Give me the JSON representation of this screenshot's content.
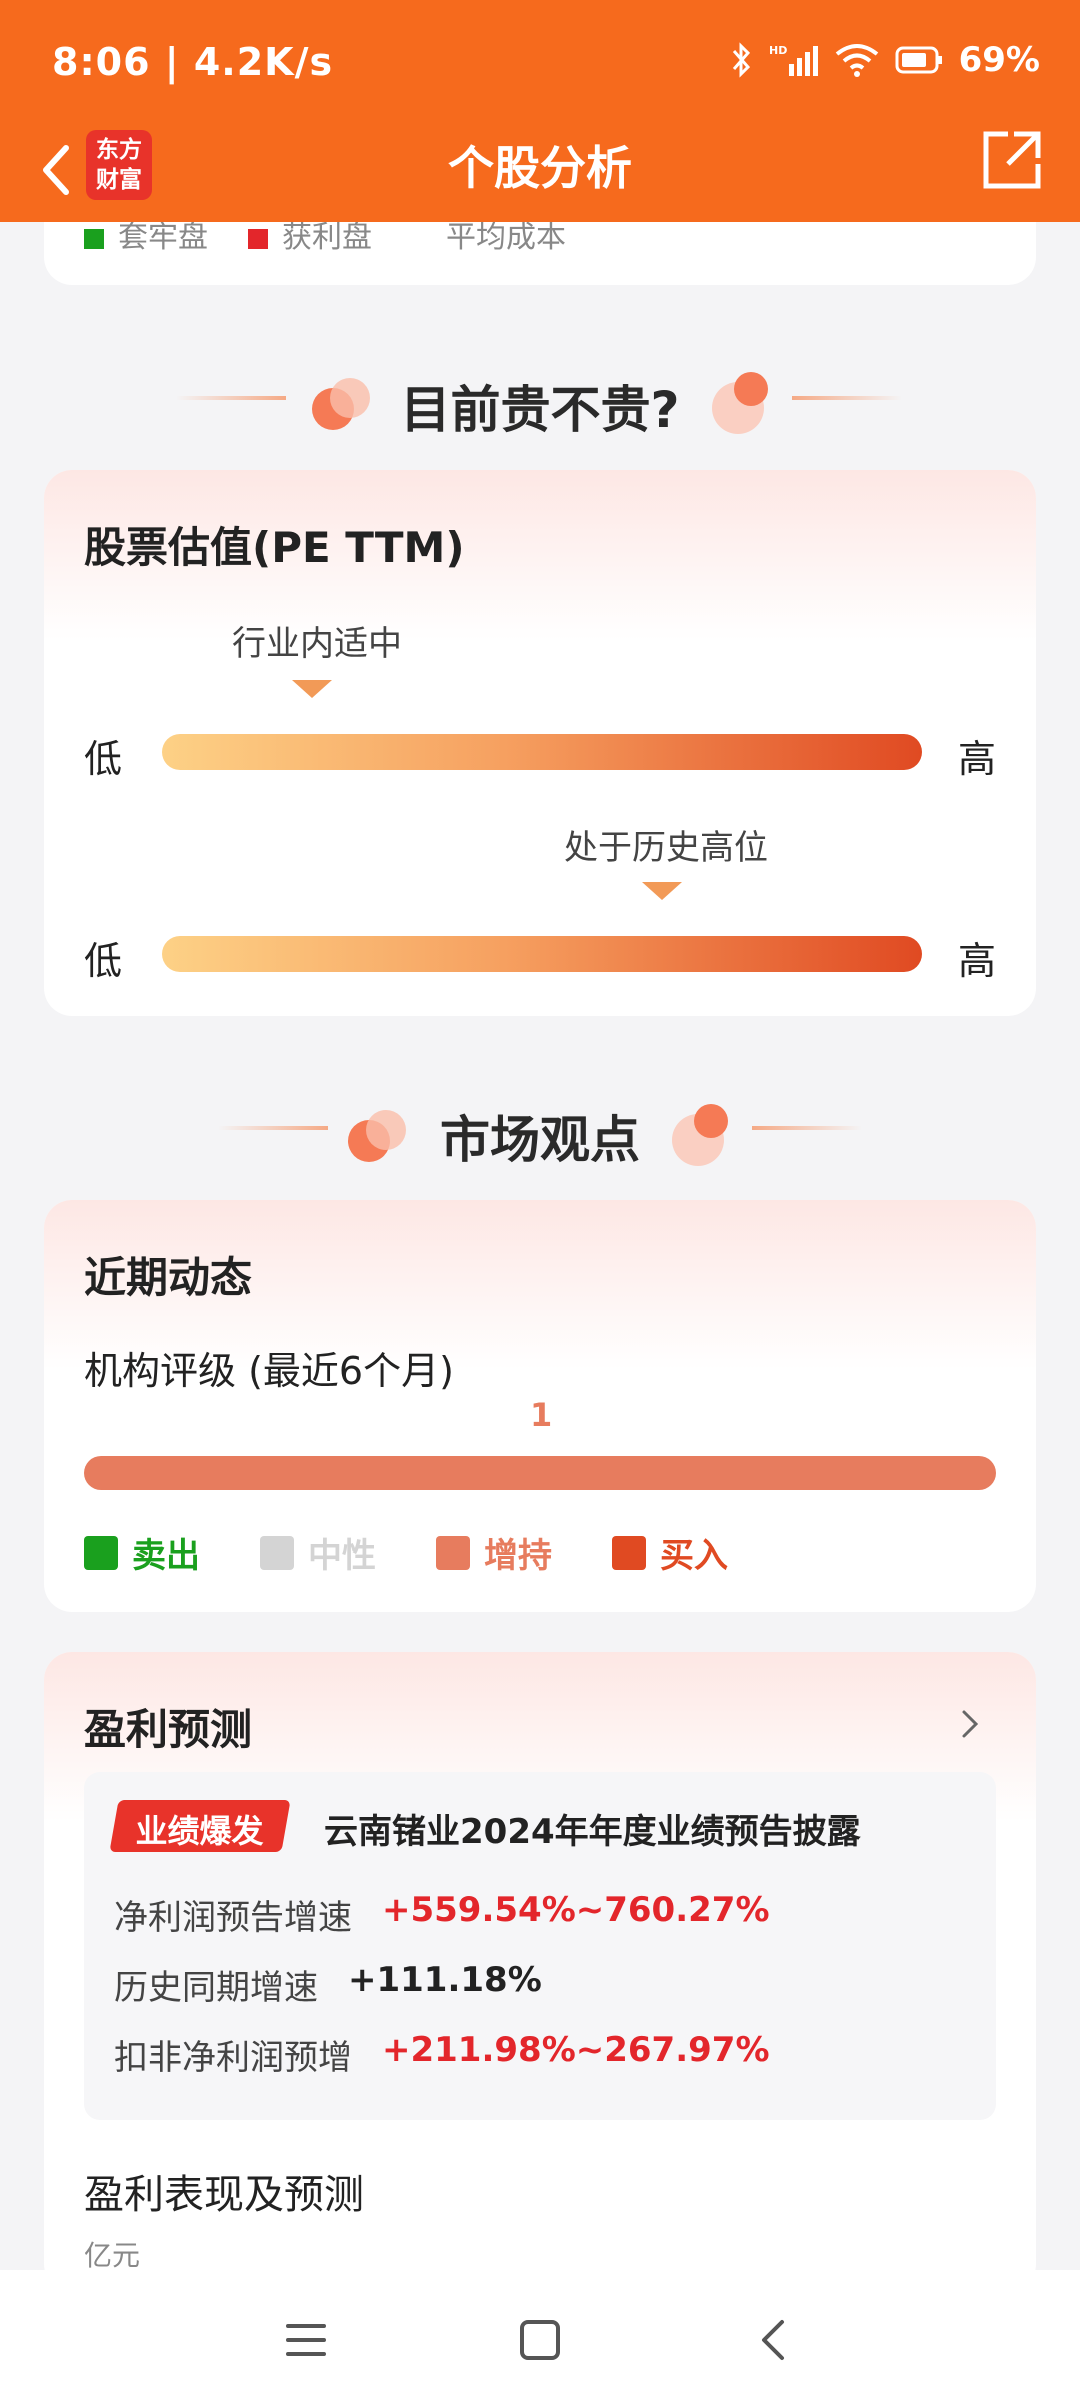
{
  "status_bar": {
    "time": "8:06 | 4.2K/s",
    "battery": "69%"
  },
  "header": {
    "title": "个股分析",
    "logo_line1": "东方",
    "logo_line2": "财富"
  },
  "top_card": {
    "legend": [
      "套牢盘",
      "获利盘",
      "平均成本"
    ]
  },
  "valuation_section": {
    "heading": "目前贵不贵?",
    "card_title": "股票估值(PE TTM)",
    "row1": {
      "marker_label": "行业内适中",
      "low": "低",
      "high": "高"
    },
    "row2": {
      "marker_label": "处于历史高位",
      "low": "低",
      "high": "高"
    }
  },
  "market_section": {
    "heading": "市场观点",
    "card_title": "近期动态",
    "rating_title": "机构评级 (最近6个月)",
    "rating_count": "1",
    "legend": [
      {
        "label": "卖出",
        "color": "#1aa01e"
      },
      {
        "label": "中性",
        "color": "#d4d4d4"
      },
      {
        "label": "增持",
        "color": "#e77c5e"
      },
      {
        "label": "买入",
        "color": "#e04a22"
      }
    ]
  },
  "forecast": {
    "card_title": "盈利预测",
    "badge": "业绩爆发",
    "headline": "云南锗业2024年年度业绩预告披露",
    "rows": [
      {
        "label": "净利润预告增速",
        "value": "+559.54%~760.27%"
      },
      {
        "label": "历史同期增速",
        "value": "+111.18%"
      },
      {
        "label": "扣非净利润预增",
        "value": "+211.98%~267.97%"
      }
    ],
    "sub_title": "盈利表现及预测",
    "unit": "亿元"
  },
  "colors": {
    "brand": "#f66a1d",
    "red": "#e3262b"
  }
}
